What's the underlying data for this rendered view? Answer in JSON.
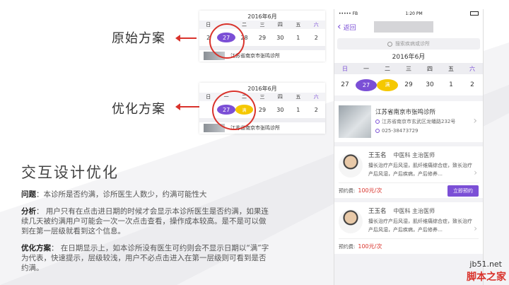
{
  "labels": {
    "original": "原始方案",
    "optimized": "优化方案"
  },
  "mini_original": {
    "title": "2016年6月",
    "weekdays": [
      "日",
      "一",
      "二",
      "三",
      "四",
      "五",
      "六"
    ],
    "days": [
      "2",
      "27",
      "28",
      "29",
      "30",
      "1",
      "2"
    ],
    "clinic": "江苏省南京市张鸣诊所"
  },
  "mini_optimized": {
    "title": "2016年6月",
    "weekdays": [
      "日",
      "一",
      "二",
      "三",
      "四",
      "五",
      "六"
    ],
    "days": [
      "",
      "27",
      "满",
      "29",
      "30",
      "1",
      "2"
    ],
    "clinic": "江苏省南京市张鸣诊所"
  },
  "content": {
    "headline": "交互设计优化",
    "problem_label": "问题",
    "problem_text": "：本诊所是否约满，诊所医生人数少，约满可能性大",
    "analysis_label": "分析",
    "analysis_text": "：  用户只有在点击进日期的时候才会显示本诊所医生是否约满，如果连续几天被约满用户可能会一次一次点击查看，操作成本较高。是不是可以做到在第一层级就看到这个信息。",
    "solution_label": "优化方案",
    "solution_text": "：  在日期显示上，如本诊所没有医生可约则会不显示日期以“满”字为代表，快速提示，层级较浅，用户不必点击进入在第一层级则可看到是否约满。"
  },
  "phone": {
    "status_left": "••••• FB",
    "status_time": "1:20 PM",
    "back_label": "返回",
    "search_placeholder": "搜索疾病或诊所",
    "month": "2016年6月",
    "weekdays": [
      "日",
      "一",
      "二",
      "三",
      "四",
      "五",
      "六"
    ],
    "days": [
      "27",
      "27",
      "满",
      "29",
      "30",
      "1",
      "2"
    ],
    "clinic": {
      "name": "江苏省南京市张鸣诊所",
      "address": "江苏省南京市玄武区龙蟠路232号",
      "phone": "025-38473729"
    },
    "doctors": [
      {
        "name": "王玉名",
        "dept": "中医科  主治医师",
        "specialty": "擅长治疗产后风湿，肌纤维痛综合症，致长治疗产后风湿，产后疾病，产后修养…",
        "fee_label": "预约费:",
        "fee": "100元/次",
        "book_label": "立即预约"
      },
      {
        "name": "王玉名",
        "dept": "中医科  主治医师",
        "specialty": "擅长治疗产后风湿，肌纤维痛综合症，致长治疗产后风湿，产后疾病，产后修养…",
        "fee_label": "预约费:",
        "fee": "100元/次",
        "book_label": ""
      }
    ]
  },
  "watermark": {
    "url": "jb51.net",
    "text": "脚本之家"
  },
  "colors": {
    "accent": "#7b4fd6",
    "full": "#f5c800",
    "highlight": "#d9332c"
  }
}
